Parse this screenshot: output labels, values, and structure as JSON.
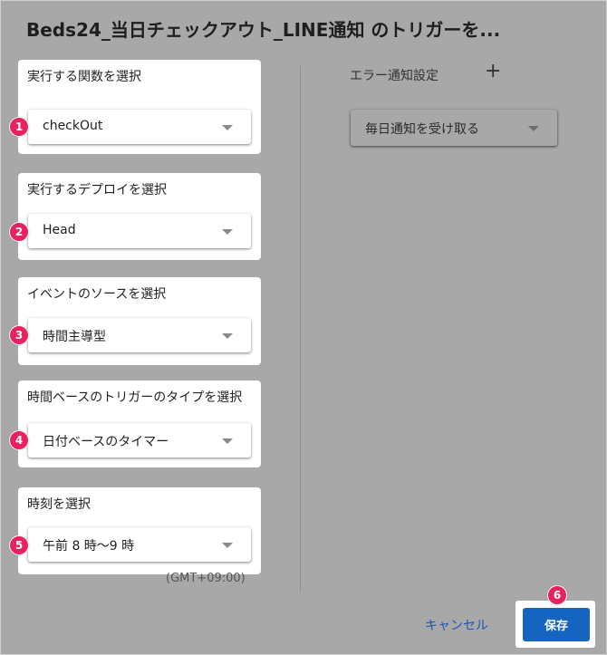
{
  "dialog": {
    "title": "Beds24_当日チェックアウト_LINE通知 のトリガーを..."
  },
  "fields": [
    {
      "label": "実行する関数を選択",
      "value": "checkOut",
      "badge": "1"
    },
    {
      "label": "実行するデプロイを選択",
      "value": "Head",
      "badge": "2"
    },
    {
      "label": "イベントのソースを選択",
      "value": "時間主導型",
      "badge": "3"
    },
    {
      "label": "時間ベースのトリガーのタイプを選択",
      "value": "日付ベースのタイマー",
      "badge": "4"
    },
    {
      "label": "時刻を選択",
      "value": "午前 8 時～9 時",
      "badge": "5"
    }
  ],
  "timezone": "(GMT+09:00)",
  "error_notification": {
    "label": "エラー通知設定",
    "add_icon": "+",
    "value": "毎日通知を受け取る"
  },
  "footer": {
    "cancel_label": "キャンセル",
    "save_label": "保存",
    "save_badge": "6"
  },
  "colors": {
    "badge": "#e8215f",
    "save_button": "#1565c0",
    "cancel_link": "#1d55b8",
    "overlay": "#a8a8a8"
  }
}
